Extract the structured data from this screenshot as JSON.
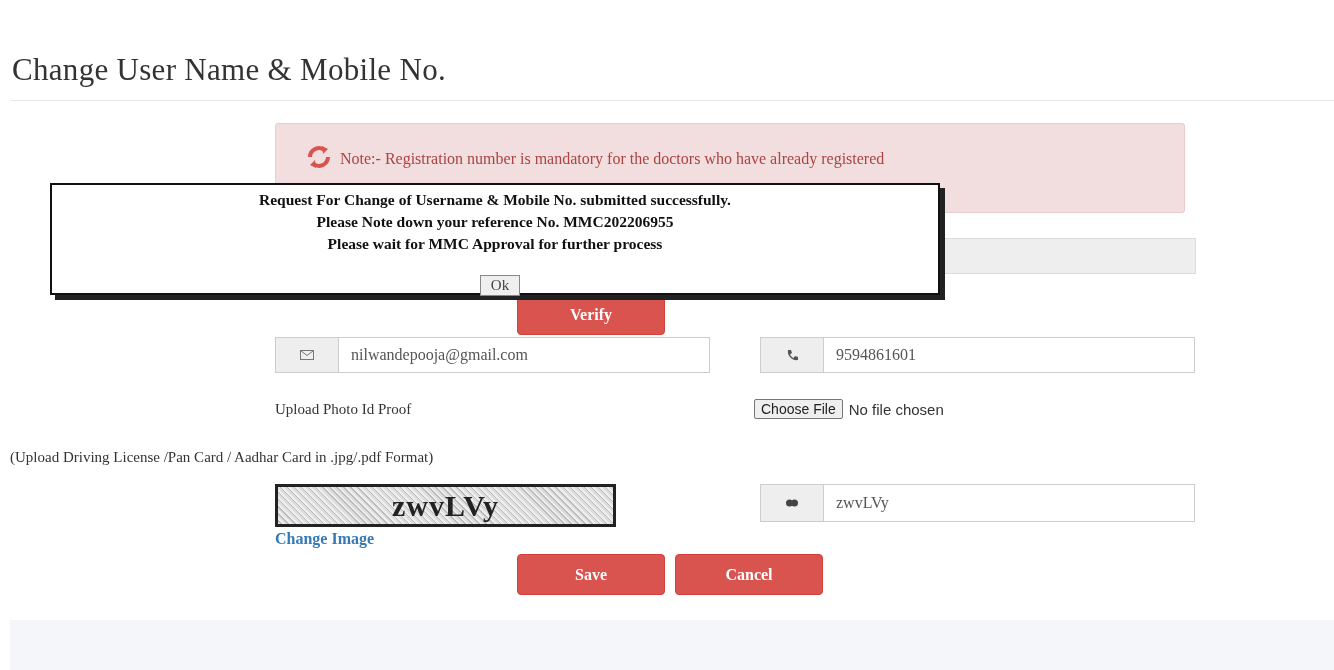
{
  "page": {
    "title": "Change User Name & Mobile No."
  },
  "note": {
    "text": "Note:- Registration number is mandatory for the doctors who have already registered"
  },
  "verify_button": {
    "label": "Verify"
  },
  "email": {
    "value": "nilwandepooja@gmail.com"
  },
  "mobile": {
    "value": "9594861601"
  },
  "upload": {
    "label": "Upload Photo Id Proof",
    "button": "Choose File",
    "status": "No file chosen"
  },
  "upload_hint": "(Upload Driving License /Pan Card / Aadhar Card in .jpg/.pdf Format)",
  "captcha": {
    "image_text": "zwvLVy",
    "value": "zwvLVy",
    "change_link": "Change Image"
  },
  "buttons": [
    {
      "label": "Save"
    },
    {
      "label": "Cancel"
    }
  ],
  "dialog": {
    "lines": [
      "Request For Change of Username & Mobile No. submitted successfully.",
      "Please Note down your reference No. MMC202206955",
      "Please wait for MMC Approval for further process"
    ],
    "button": "Ok"
  }
}
